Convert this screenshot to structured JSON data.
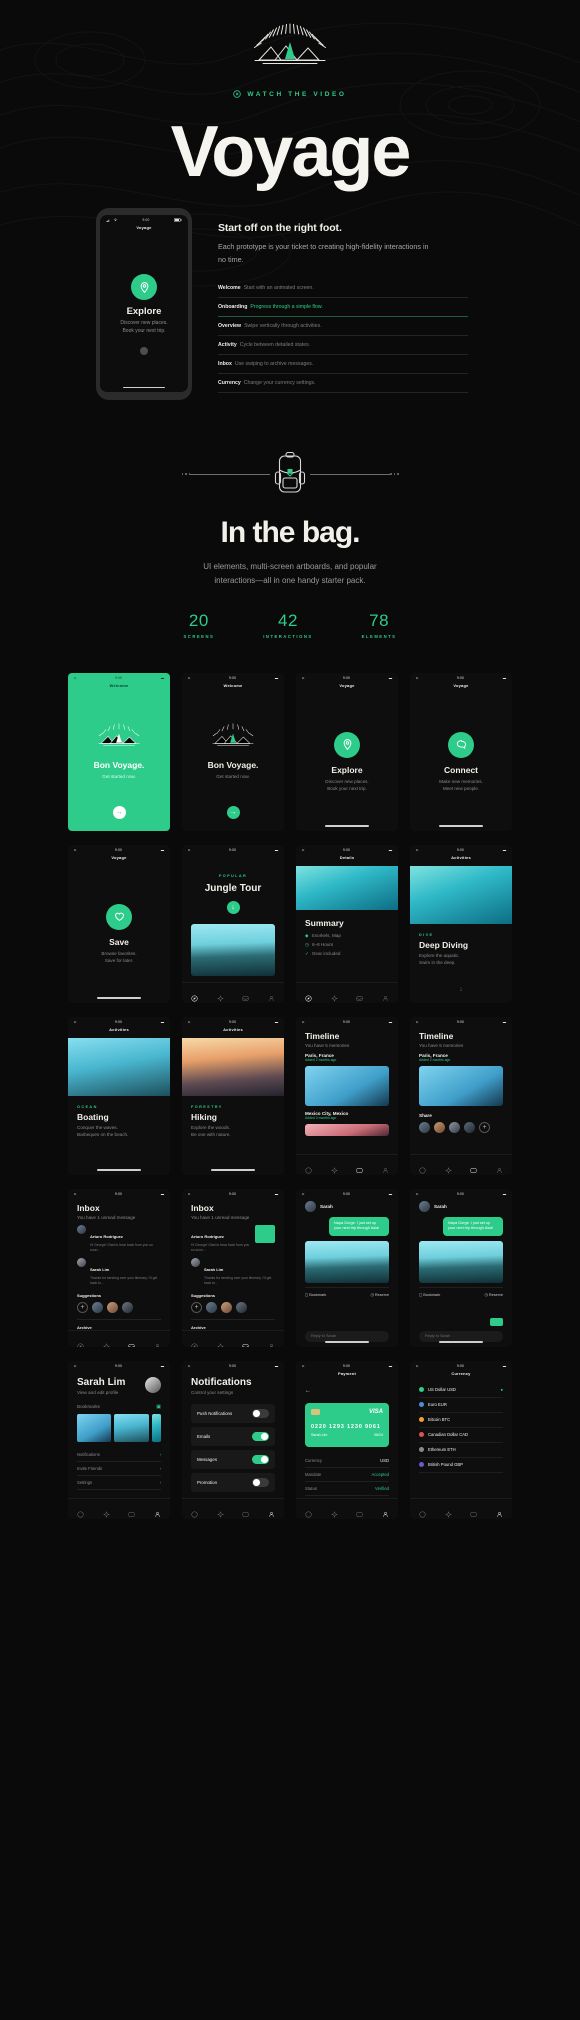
{
  "hero": {
    "eyebrow": "WATCH THE VIDEO",
    "title": "Voyage",
    "logo_icon": "sunburst-mountain-logo",
    "play_icon": "play-circle-icon"
  },
  "start_section": {
    "heading": "Start off on the right foot.",
    "lead": "Each prototype is your ticket to creating high-fidelity interactions in no time.",
    "phone": {
      "status_time": "9:00",
      "nav_title": "Voyage",
      "icon": "location-pin-icon",
      "title": "Explore",
      "subtitle_line1": "Discover new places.",
      "subtitle_line2": "Book your next trip."
    },
    "features": [
      {
        "name": "Welcome",
        "desc": "Start with an animated screen.",
        "highlight": false
      },
      {
        "name": "Onboarding",
        "desc": "Progress through a simple flow.",
        "highlight": true
      },
      {
        "name": "Overview",
        "desc": "Swipe vertically through activities.",
        "highlight": false
      },
      {
        "name": "Activity",
        "desc": "Cycle between detailed states.",
        "highlight": false
      },
      {
        "name": "Inbox",
        "desc": "Use swiping to archive messages.",
        "highlight": false
      },
      {
        "name": "Currency",
        "desc": "Change your currency settings.",
        "highlight": false
      }
    ]
  },
  "bag_section": {
    "icon": "backpack-icon",
    "title": "In the bag.",
    "subtitle_line1": "UI elements, multi-screen artboards, and popular",
    "subtitle_line2": "interactions—all in one handy starter pack.",
    "stats": [
      {
        "number": "20",
        "label": "SCREENS"
      },
      {
        "number": "42",
        "label": "INTERACTIONS"
      },
      {
        "number": "78",
        "label": "ELEMENTS"
      }
    ]
  },
  "common": {
    "status_time": "9:00",
    "plus": "+",
    "arrow_right": "→",
    "arrow_down": "↓"
  },
  "cards": {
    "welcome_green": {
      "nav": "Welcome",
      "title": "Bon Voyage.",
      "sub": "Get started now."
    },
    "welcome_dark": {
      "nav": "Welcome",
      "title": "Bon Voyage.",
      "sub": "Get started now."
    },
    "explore": {
      "nav": "Voyage",
      "icon": "location-pin-icon",
      "title": "Explore",
      "sub1": "Discover new places.",
      "sub2": "Book your next trip."
    },
    "connect": {
      "nav": "Voyage",
      "icon": "chat-bubble-icon",
      "title": "Connect",
      "sub1": "Make new memories.",
      "sub2": "Meet new people."
    },
    "save": {
      "nav": "Voyage",
      "icon": "heart-icon",
      "title": "Save",
      "sub1": "Browse favorites.",
      "sub2": "Save for later."
    },
    "jungle": {
      "label": "POPULAR",
      "title": "Jungle Tour",
      "icon": "arrow-down-icon"
    },
    "details": {
      "nav": "Details",
      "title": "Summary",
      "items": [
        "Snorkels, Map",
        "6–8 Hours",
        "Gear included"
      ]
    },
    "activities_dive": {
      "nav": "Activities",
      "label": "DIVE",
      "title": "Deep Diving",
      "sub1": "Explore the aquatic.",
      "sub2": "Swim in the deep."
    },
    "activities_boat": {
      "nav": "Activities",
      "label": "OCEAN",
      "title": "Boating",
      "sub1": "Conquer the waves.",
      "sub2": "Barbeques on the beach."
    },
    "activities_hike": {
      "nav": "Activities",
      "label": "FORESTRY",
      "title": "Hiking",
      "sub1": "Explore the woods.",
      "sub2": "Be one with nature."
    },
    "timeline_a": {
      "nav": "Timeline",
      "title": "Timeline",
      "sub": "You have 5 memories",
      "place": "Paris, France",
      "when": "Added 2 months ago"
    },
    "timeline_b": {
      "nav": "Timeline",
      "title": "Timeline",
      "sub": "You have 5 memories",
      "place": "Paris, France",
      "when": "Added 2 months ago",
      "place2": "Share"
    },
    "timeline_mid": {
      "place2": "Mexico City, Mexico",
      "when2": "Added 3 months ago"
    },
    "inbox_a": {
      "nav": "Inbox",
      "title": "Inbox",
      "sub": "You have 1 unread message",
      "suggestions": "Suggestions",
      "archive": "Archive",
      "messages": [
        {
          "name": "Arturo Rodriguez",
          "text": "Hi George! Glad to hear back from you so soon..."
        },
        {
          "name": "Sarah Lim",
          "text": "Thanks for sending over your itinerary. I'll get back to..."
        }
      ]
    },
    "inbox_b": {
      "nav": "Inbox",
      "title": "Inbox",
      "sub": "You have 1 unread message",
      "suggestions": "Suggestions",
      "archive": "Archive",
      "messages": [
        {
          "name": "Arturo Rodriguez",
          "text": "Hi George! Glad to hear back from you so soon..."
        },
        {
          "name": "Sarah Lim",
          "text": "Thanks for sending over your itinerary. I'll get back to..."
        }
      ]
    },
    "chat_a": {
      "nav": "Sarah",
      "bubble": "Napa Gorge. I just set up your next trip through Asia!",
      "bookmark": "Bookmark",
      "reserve": "Reserve",
      "input_placeholder": "Reply to Sarah"
    },
    "chat_b": {
      "nav": "Sarah",
      "bubble": "Napa Gorge. I just set up your next trip through Asia!",
      "bookmark": "Bookmark",
      "reserve": "Reserve",
      "input_placeholder": "Reply to Sarah"
    },
    "profile": {
      "name": "Sarah Lim",
      "sub": "View and edit profile",
      "bookmarks": "Bookmarks",
      "rows": [
        "Notifications",
        "Invite Friends",
        "Settings"
      ]
    },
    "notifications": {
      "title": "Notifications",
      "sub": "Control your settings",
      "toggles": [
        {
          "label": "Push Notifications",
          "on": false
        },
        {
          "label": "Emails",
          "on": true
        },
        {
          "label": "Messages",
          "on": true
        },
        {
          "label": "Promotion",
          "on": false
        }
      ]
    },
    "payment": {
      "nav": "Payment",
      "brand": "VISA",
      "number": "0220  1293  1230  9061",
      "holder_label": "Sarah Lim",
      "exp": "06/24",
      "rows": [
        {
          "k": "Currency",
          "v": "USD",
          "ok": false
        },
        {
          "k": "Mandate",
          "v": "Accepted",
          "ok": true
        },
        {
          "k": "Status",
          "v": "Verified",
          "ok": true
        }
      ]
    },
    "currency": {
      "nav": "Currency",
      "rows": [
        {
          "name": "US Dollar USD",
          "color": "#2ecc8a",
          "selected": true
        },
        {
          "name": "Euro EUR",
          "color": "#4a90d9",
          "selected": false
        },
        {
          "name": "Bitcoin BTC",
          "color": "#f0a030",
          "selected": false
        },
        {
          "name": "Canadian Dollar CAD",
          "color": "#e05252",
          "selected": false
        },
        {
          "name": "Ethereum ETH",
          "color": "#8a8a8a",
          "selected": false
        },
        {
          "name": "British Pound GBP",
          "color": "#6a5acd",
          "selected": false
        }
      ]
    }
  },
  "colors": {
    "accent": "#2ecc8a",
    "bg": "#0a0a0a",
    "text": "#f2f0ea"
  }
}
